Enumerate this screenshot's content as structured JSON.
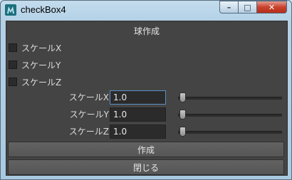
{
  "window": {
    "title": "checkBox4",
    "minimize_glyph": "–",
    "maximize_glyph": "□",
    "close_glyph": "✕"
  },
  "frame": {
    "label": "球作成"
  },
  "checkboxes": [
    {
      "label": "スケールX",
      "checked": false
    },
    {
      "label": "スケールY",
      "checked": false
    },
    {
      "label": "スケールZ",
      "checked": false
    }
  ],
  "sliders": [
    {
      "label": "スケールX",
      "value": "1.0",
      "level": 0.0
    },
    {
      "label": "スケールY",
      "value": "1.0",
      "level": 0.0
    },
    {
      "label": "スケールZ",
      "value": "1.0",
      "level": 0.0
    }
  ],
  "buttons": {
    "create": "作成",
    "close": "閉じる"
  },
  "colors": {
    "panel": "#444444",
    "field": "#2b2b2b",
    "focus": "#5a8fc4",
    "close_button": "#c8422d"
  }
}
